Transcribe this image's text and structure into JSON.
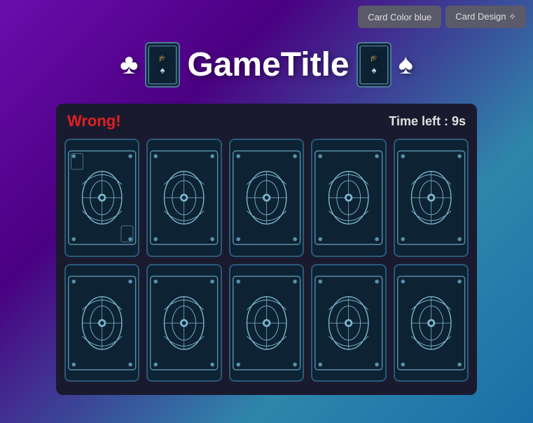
{
  "topBar": {
    "cardColorBtn": "Card Color blue",
    "cardDesignBtn": "Card Design ✧"
  },
  "title": {
    "text": "GameTitle",
    "leftSymbols": [
      "♣",
      "🂡"
    ],
    "rightSymbols": [
      "🂡",
      "♠"
    ]
  },
  "panel": {
    "wrongText": "Wrong!",
    "timerText": "Time left : 9s"
  },
  "cardGrid": {
    "rows": 2,
    "cols": 5,
    "total": 10
  }
}
